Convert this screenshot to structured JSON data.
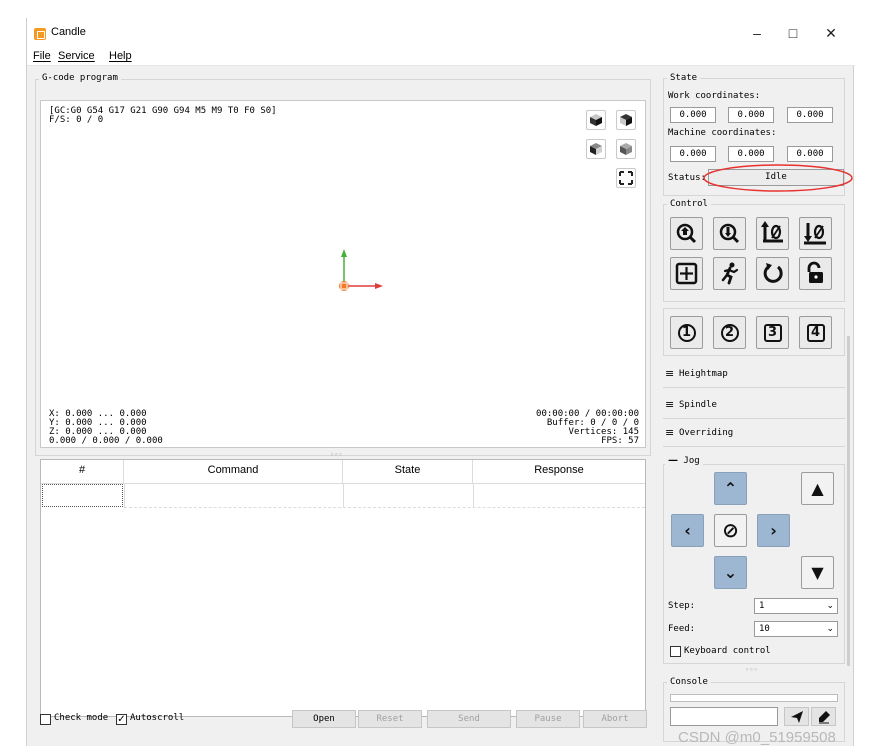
{
  "window": {
    "title": "Candle",
    "minimize": "–",
    "maximize": "□",
    "close": "✕"
  },
  "menu": [
    "File",
    "Service",
    "Help"
  ],
  "gcode_group": {
    "title": "G-code program",
    "status_line1": "[GC:G0 G54 G17 G21 G90 G94 M5 M9 T0 F0 S0]",
    "status_line2": "F/S: 0 / 0",
    "coords_left": [
      "X: 0.000 ... 0.000",
      "Y: 0.000 ... 0.000",
      "Z: 0.000 ... 0.000",
      "0.000 / 0.000 / 0.000"
    ],
    "stats_right": [
      "00:00:00 / 00:00:00",
      "Buffer: 0 / 0 / 0",
      "Vertices: 145",
      "FPS: 57"
    ],
    "splitter": "◦◦◦"
  },
  "table": {
    "columns": [
      "#",
      "Command",
      "State",
      "Response"
    ]
  },
  "bottom_bar": {
    "check_mode": "Check mode",
    "autoscroll": "Autoscroll",
    "autoscroll_checked": true,
    "check_mode_checked": false,
    "buttons": [
      "Open",
      "Reset",
      "Send",
      "Pause",
      "Abort"
    ]
  },
  "state": {
    "title": "State",
    "work_label": "Work coordinates:",
    "work": [
      "0.000",
      "0.000",
      "0.000"
    ],
    "machine_label": "Machine coordinates:",
    "machine": [
      "0.000",
      "0.000",
      "0.000"
    ],
    "status_label": "Status:",
    "status_value": "Idle",
    "highlight_color": "#e8312f"
  },
  "control": {
    "title": "Control"
  },
  "user_buttons": [
    "1",
    "2",
    "3",
    "4"
  ],
  "collapsed": [
    {
      "icon": "≡",
      "label": "Heightmap"
    },
    {
      "icon": "≡",
      "label": "Spindle"
    },
    {
      "icon": "≡",
      "label": "Overriding"
    }
  ],
  "jog": {
    "icon": "—",
    "title": "Jog",
    "step_label": "Step:",
    "step_value": "1",
    "feed_label": "Feed:",
    "feed_value": "10",
    "keyboard_label": "Keyboard control",
    "jog_color": "#9db7d2"
  },
  "console": {
    "title": "Console",
    "splitter": "◦◦◦"
  },
  "watermark": "CSDN @m0_51959508"
}
